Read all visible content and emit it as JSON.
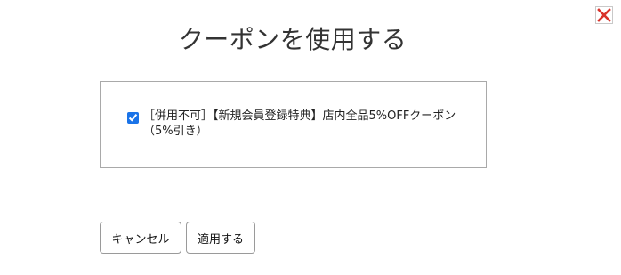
{
  "dialog": {
    "title": "クーポンを使用する",
    "close_icon": "close-x-icon",
    "close_color": "#d9322b"
  },
  "coupons": [
    {
      "checked": true,
      "label": "［併用不可］【新規会員登録特典】店内全品5%OFFクーポン（5%引き）"
    }
  ],
  "buttons": {
    "cancel_label": "キャンセル",
    "apply_label": "適用する"
  }
}
